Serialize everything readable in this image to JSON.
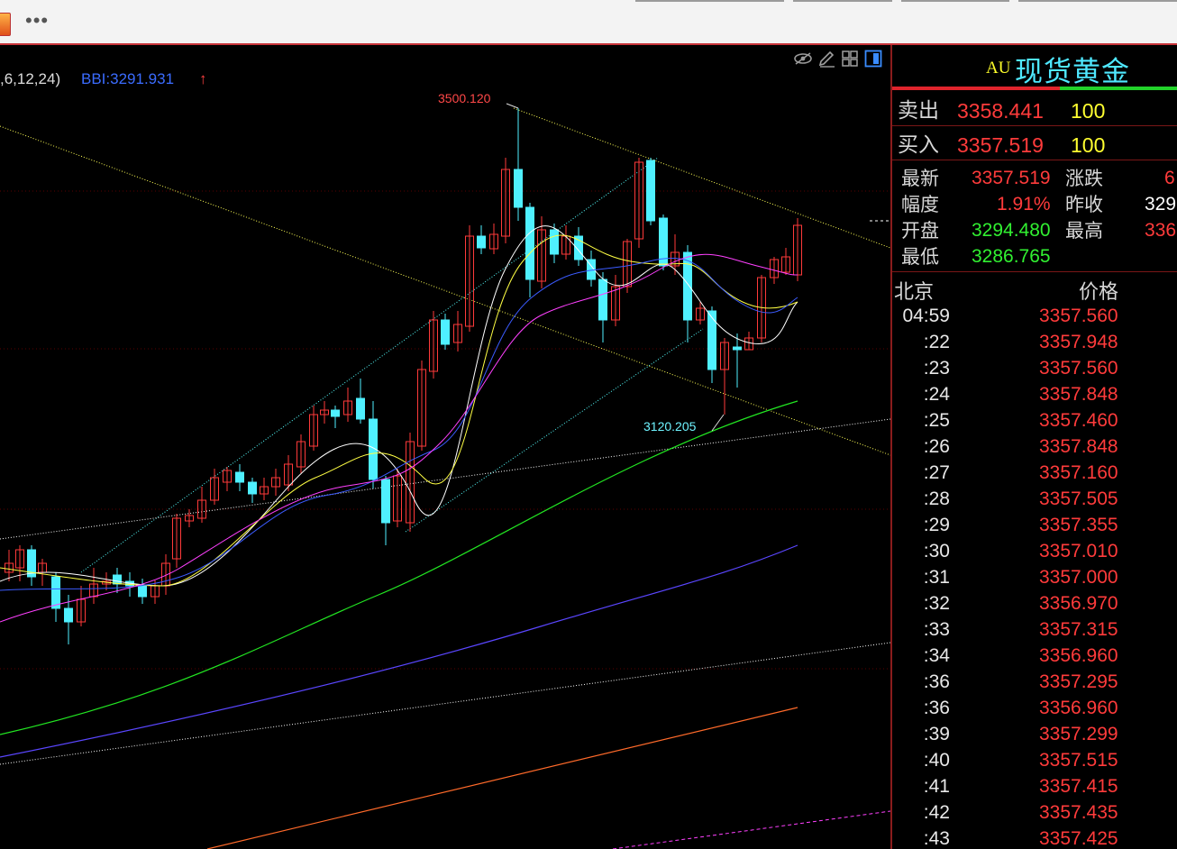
{
  "toolbar": {
    "more_icon": "more-dots-icon",
    "app_icon": "app-logo-icon"
  },
  "chart": {
    "indicator_params": ",6,12,24)",
    "bbi_label": "BBI:3291.931",
    "bbi_arrow": "↑",
    "high_annotation": "3500.120",
    "low_annotation": "3120.205",
    "tool_icons": [
      "eye-hide-icon",
      "pencil-draw-icon",
      "grid-layout-icon",
      "panel-toggle-icon"
    ],
    "colors": {
      "up_candle": "#ff3a3a",
      "down_candle": "#4ff0ff",
      "ma_white": "#ffffff",
      "ma_yellow": "#ffff44",
      "ma_magenta": "#ff40ff",
      "ma_blue": "#3b5bff",
      "ma_green": "#22e622",
      "ma_purple": "#5a46ff",
      "ma_orange": "#ff6a2a",
      "trend_yellow": "#ffff55",
      "trend_cyan": "#55ffff",
      "trend_white": "#ffffff"
    }
  },
  "panel": {
    "code": "AU",
    "name": "现货黄金",
    "sell_label": "卖出",
    "sell_price": "3358.441",
    "sell_qty": "100",
    "buy_label": "买入",
    "buy_price": "3357.519",
    "buy_qty": "100",
    "stats": {
      "latest_label": "最新",
      "latest_value": "3357.519",
      "change_label": "涨跌",
      "change_value": "6",
      "amp_label": "幅度",
      "amp_value": "1.91%",
      "prev_close_label": "昨收",
      "prev_close_value": "329",
      "open_label": "开盘",
      "open_value": "3294.480",
      "high_label": "最高",
      "high_value": "336",
      "low_label": "最低",
      "low_value": "3286.765"
    },
    "ticks_header": {
      "time": "北京",
      "price": "价格"
    },
    "ticks": [
      {
        "time": "04:59",
        "price": "3357.560"
      },
      {
        "time": ":22",
        "price": "3357.948"
      },
      {
        "time": ":23",
        "price": "3357.560"
      },
      {
        "time": ":24",
        "price": "3357.848"
      },
      {
        "time": ":25",
        "price": "3357.460"
      },
      {
        "time": ":26",
        "price": "3357.848"
      },
      {
        "time": ":27",
        "price": "3357.160"
      },
      {
        "time": ":28",
        "price": "3357.505"
      },
      {
        "time": ":29",
        "price": "3357.355"
      },
      {
        "time": ":30",
        "price": "3357.010"
      },
      {
        "time": ":31",
        "price": "3357.000"
      },
      {
        "time": ":32",
        "price": "3356.970"
      },
      {
        "time": ":33",
        "price": "3357.315"
      },
      {
        "time": ":34",
        "price": "3356.960"
      },
      {
        "time": ":36",
        "price": "3357.295"
      },
      {
        "time": ":36",
        "price": "3356.960"
      },
      {
        "time": ":39",
        "price": "3357.299"
      },
      {
        "time": ":40",
        "price": "3357.515"
      },
      {
        "time": ":41",
        "price": "3357.415"
      },
      {
        "time": ":42",
        "price": "3357.435"
      },
      {
        "time": ":43",
        "price": "3357.425"
      }
    ]
  }
}
